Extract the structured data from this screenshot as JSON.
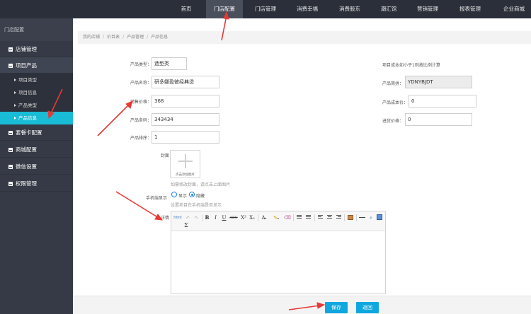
{
  "topnav": {
    "items": [
      "首页",
      "门店配置",
      "门店管理",
      "消费幸福",
      "消费股东",
      "潮汇馆",
      "营销管理",
      "报表管理",
      "企业商城"
    ],
    "active": "门店配置"
  },
  "sidebar": {
    "title": "门店配置",
    "groups": [
      {
        "label": "店铺管理"
      },
      {
        "label": "项目产品"
      },
      {
        "label": "套餐卡配置"
      },
      {
        "label": "商城配置"
      },
      {
        "label": "微信设置"
      },
      {
        "label": "权限管理"
      }
    ],
    "sub_items": [
      "项目类型",
      "项目信息",
      "产品类型",
      "产品信息"
    ],
    "active_sub": "产品信息"
  },
  "breadcrumb": [
    "我的店铺",
    "价目表",
    "产品管理",
    "产品信息"
  ],
  "form": {
    "product_type_label": "产品类型：",
    "product_type_value": "造型类",
    "product_name_label": "产品名称：",
    "product_name_value": "研多娜盈彼经典烫",
    "sale_price_label": "销售价格：",
    "sale_price_value": "368",
    "barcode_label": "产品条码：",
    "barcode_value": "343434",
    "sort_label": "产品排序：",
    "sort_value": "1",
    "cost_note": "项目成本如小于1则按比例计算",
    "code_label": "产品简拼：",
    "code_value": "YDNYBJDT",
    "cost_label": "产品成本价：",
    "cost_value": "0",
    "purchase_label": "进货价格：",
    "purchase_value": "0",
    "cover_label": "封面",
    "cover_upload_text": "点击添加图片",
    "cover_hint": "如需修改封面，请点击上面图片",
    "mobile_label": "手机端显示",
    "mobile_show": "显示",
    "mobile_hide": "隐藏",
    "mobile_hint": "设置项目在手机端是否显示",
    "detail_label": "详情"
  },
  "editor": {
    "toolbar_row1": [
      "html",
      "↶",
      "↷",
      "B",
      "I",
      "U",
      "ABC",
      "X²",
      "X₂",
      "A",
      "✎",
      "⌫"
    ],
    "sigma": "Σ"
  },
  "buttons": {
    "save": "保存",
    "back": "返回"
  },
  "colors": {
    "topbar": "#2b2f3a",
    "sidebar": "#353a46",
    "active_sub": "#19bcd6",
    "primary_button": "#0fa7e0",
    "annotation_arrow": "#e53935"
  }
}
